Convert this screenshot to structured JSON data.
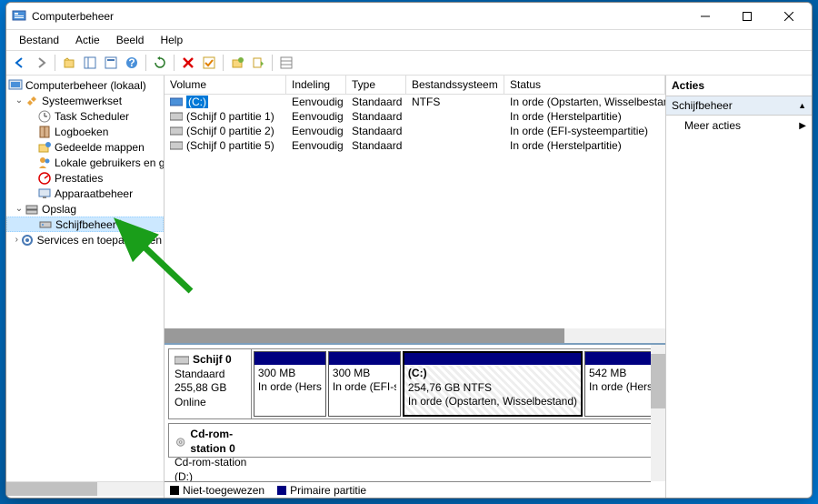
{
  "window": {
    "title": "Computerbeheer"
  },
  "menu": {
    "items": [
      "Bestand",
      "Actie",
      "Beeld",
      "Help"
    ]
  },
  "tree": {
    "root": "Computerbeheer (lokaal)",
    "group1": "Systeemwerkset",
    "g1_items": [
      "Task Scheduler",
      "Logboeken",
      "Gedeelde mappen",
      "Lokale gebruikers en groepen",
      "Prestaties",
      "Apparaatbeheer"
    ],
    "group2": "Opslag",
    "g2_items": [
      "Schijfbeheer"
    ],
    "group3": "Services en toepassingen"
  },
  "columns": {
    "c0": "Volume",
    "c1": "Indeling",
    "c2": "Type",
    "c3": "Bestandssysteem",
    "c4": "Status"
  },
  "volumes": [
    {
      "name": "(C:)",
      "layout": "Eenvoudig",
      "type": "Standaard",
      "fs": "NTFS",
      "status": "In orde (Opstarten, Wisselbestand, Crashdump, Standaard gegevenspartitie)"
    },
    {
      "name": "(Schijf 0 partitie 1)",
      "layout": "Eenvoudig",
      "type": "Standaard",
      "fs": "",
      "status": "In orde (Herstelpartitie)"
    },
    {
      "name": "(Schijf 0 partitie 2)",
      "layout": "Eenvoudig",
      "type": "Standaard",
      "fs": "",
      "status": "In orde (EFI-systeempartitie)"
    },
    {
      "name": "(Schijf 0 partitie 5)",
      "layout": "Eenvoudig",
      "type": "Standaard",
      "fs": "",
      "status": "In orde (Herstelpartitie)"
    }
  ],
  "disk0": {
    "name": "Schijf 0",
    "type": "Standaard",
    "size": "255,88 GB",
    "state": "Online",
    "parts": [
      {
        "title": "",
        "line1": "300 MB",
        "line2": "In orde (Herstelpartitie)"
      },
      {
        "title": "",
        "line1": "300 MB",
        "line2": "In orde (EFI-systeempartitie)"
      },
      {
        "title": "(C:)",
        "line1": "254,76 GB NTFS",
        "line2": "In orde (Opstarten, Wisselbestand)"
      },
      {
        "title": "",
        "line1": "542 MB",
        "line2": "In orde (Herstelpartitie)"
      }
    ]
  },
  "cdrom": {
    "name": "Cd-rom-station 0",
    "sub": "Cd-rom-station (D:)"
  },
  "legend": {
    "unalloc": "Niet-toegewezen",
    "primary": "Primaire partitie"
  },
  "actions": {
    "header": "Acties",
    "context": "Schijfbeheer",
    "more": "Meer acties"
  }
}
